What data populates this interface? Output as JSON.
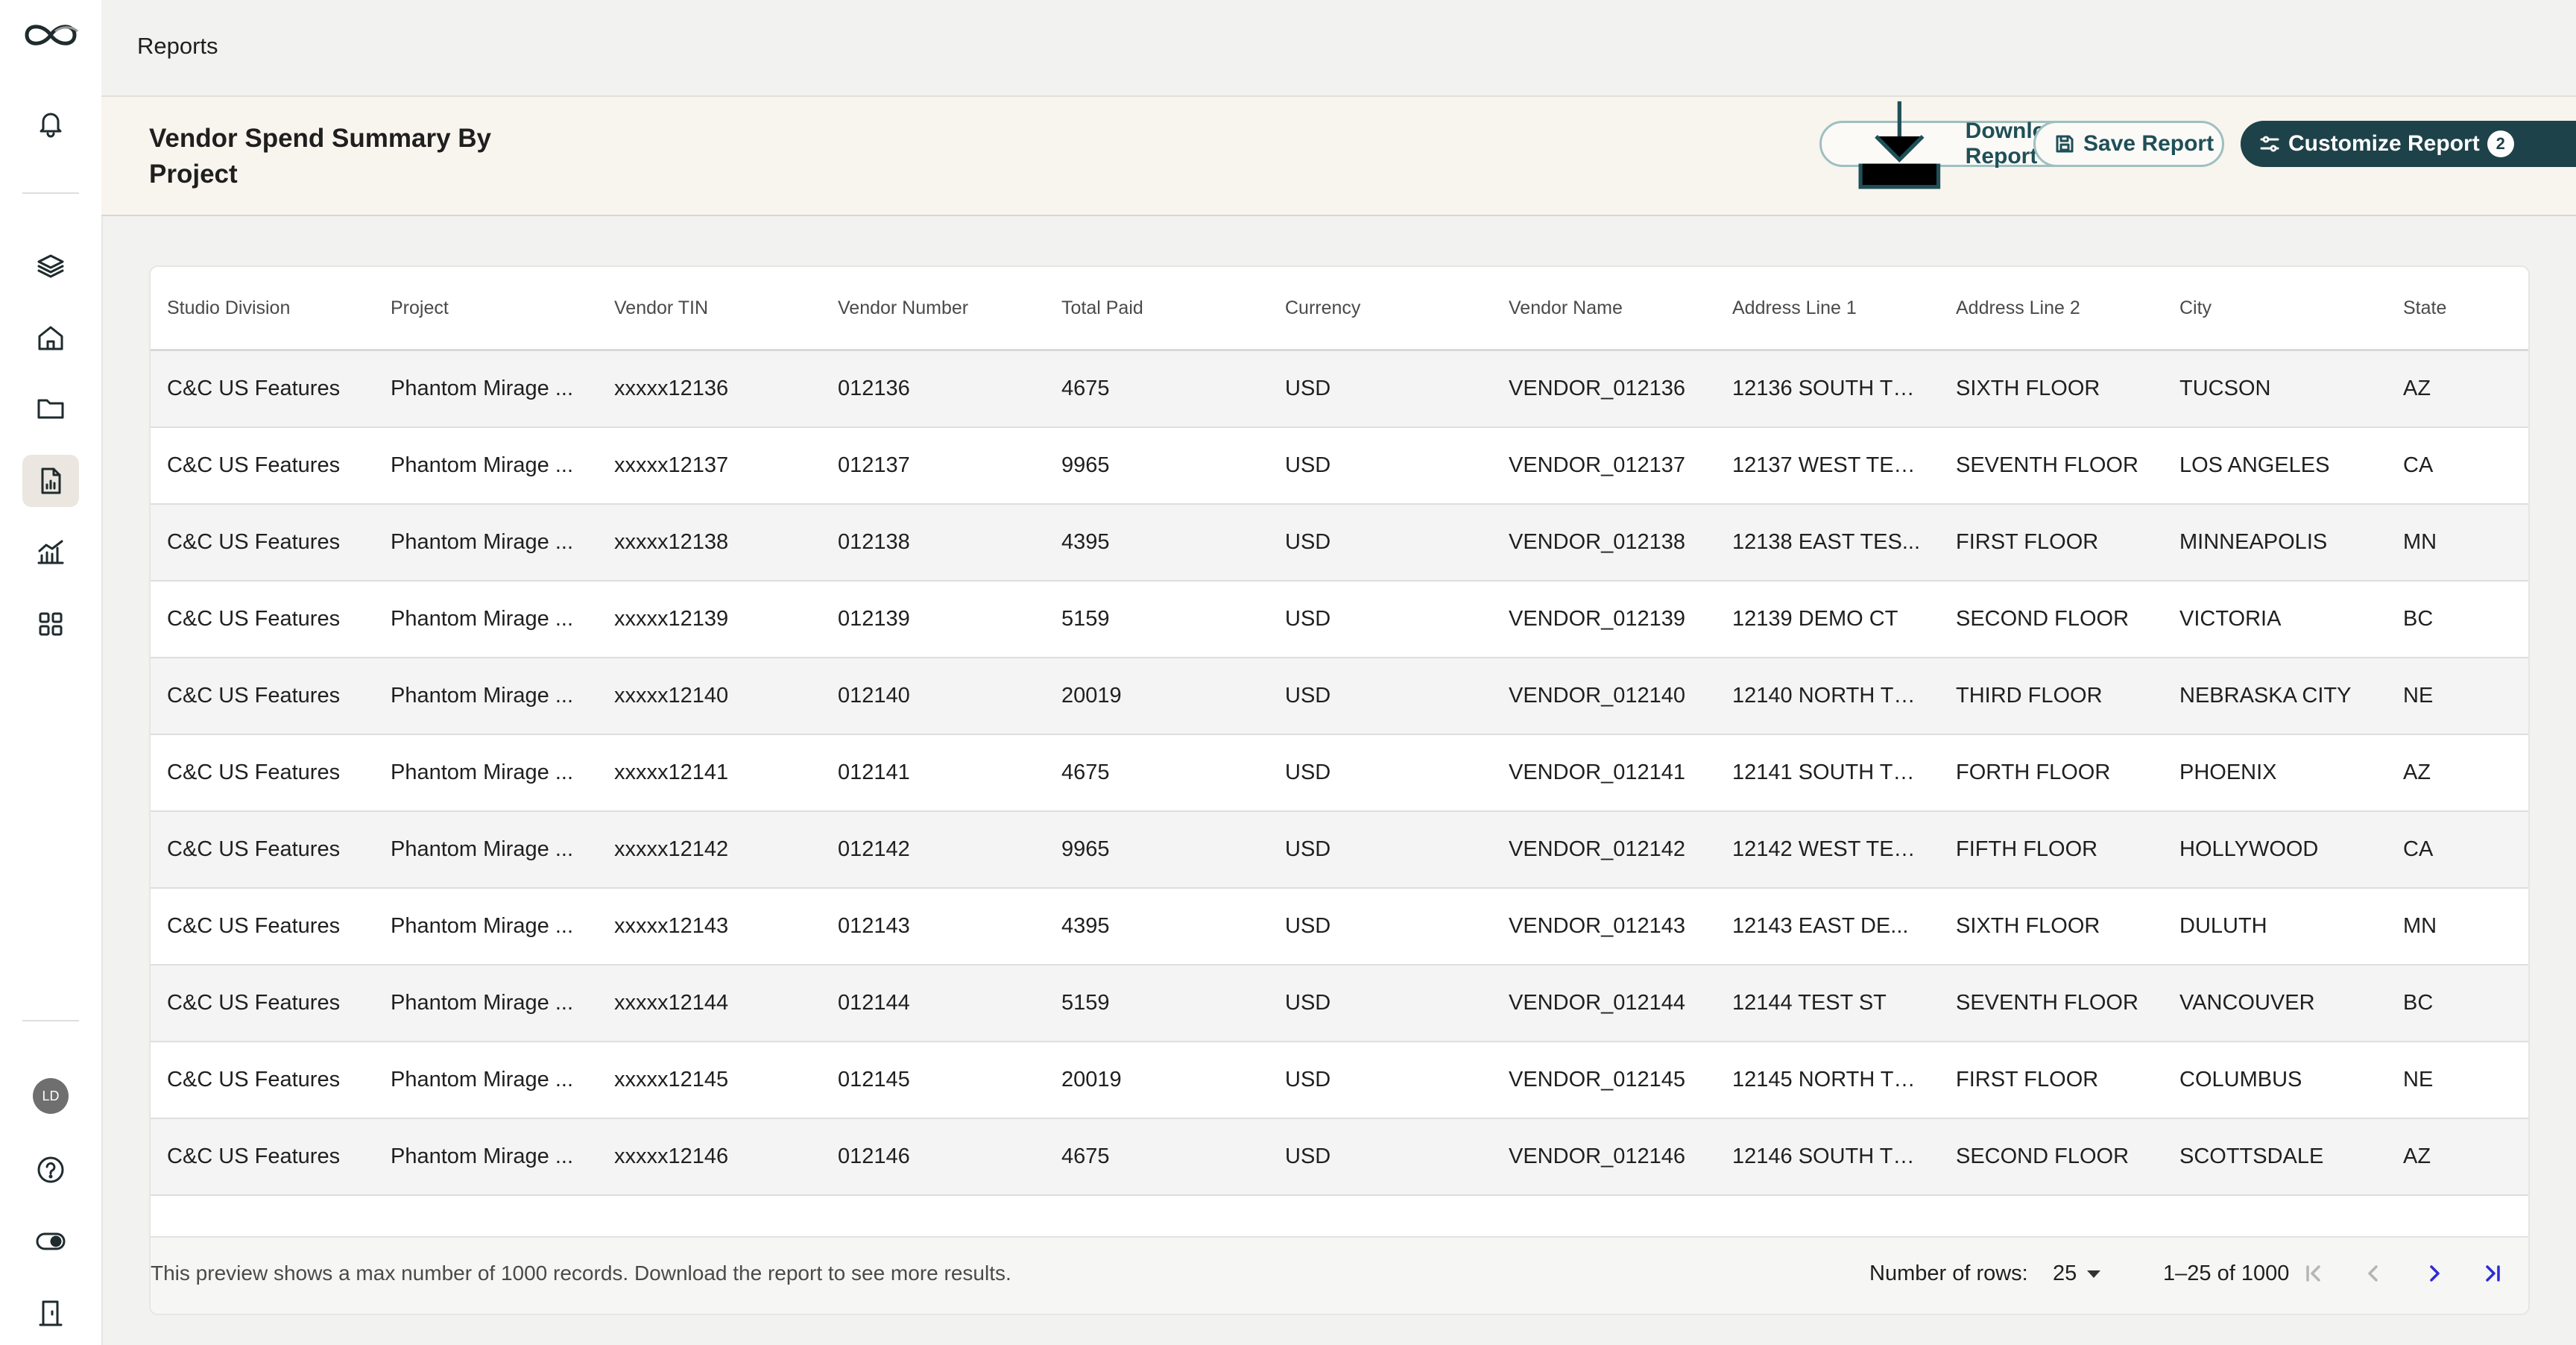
{
  "breadcrumb": "Reports",
  "page": {
    "title": "Vendor Spend Summary By Project"
  },
  "toolbar": {
    "download_label": "Download Report",
    "save_label": "Save Report",
    "customize_label": "Customize Report",
    "customize_count": "2"
  },
  "sidebar": {
    "avatar_initials": "LD",
    "items": [
      {
        "icon": "bell-icon"
      },
      {
        "icon": "layers-icon"
      },
      {
        "icon": "home-icon"
      },
      {
        "icon": "folder-icon"
      },
      {
        "icon": "report-document-icon",
        "active": true
      },
      {
        "icon": "analytics-icon"
      },
      {
        "icon": "apps-grid-icon"
      },
      {
        "icon": "help-icon"
      },
      {
        "icon": "toggle-icon"
      },
      {
        "icon": "exit-door-icon"
      }
    ]
  },
  "table": {
    "columns": [
      "Studio Division",
      "Project",
      "Vendor TIN",
      "Vendor Number",
      "Total Paid",
      "Currency",
      "Vendor Name",
      "Address Line 1",
      "Address Line 2",
      "City",
      "State"
    ],
    "rows": [
      [
        "C&C US Features",
        "Phantom Mirage ...",
        "xxxxx12136",
        "012136",
        "4675",
        "USD",
        "VENDOR_012136",
        "12136 SOUTH TE...",
        "SIXTH FLOOR",
        "TUCSON",
        "AZ"
      ],
      [
        "C&C US Features",
        "Phantom Mirage ...",
        "xxxxx12137",
        "012137",
        "9965",
        "USD",
        "VENDOR_012137",
        "12137 WEST TES...",
        "SEVENTH FLOOR",
        "LOS ANGELES",
        "CA"
      ],
      [
        "C&C US Features",
        "Phantom Mirage ...",
        "xxxxx12138",
        "012138",
        "4395",
        "USD",
        "VENDOR_012138",
        "12138 EAST TES...",
        "FIRST FLOOR",
        "MINNEAPOLIS",
        "MN"
      ],
      [
        "C&C US Features",
        "Phantom Mirage ...",
        "xxxxx12139",
        "012139",
        "5159",
        "USD",
        "VENDOR_012139",
        "12139 DEMO CT",
        "SECOND FLOOR",
        "VICTORIA",
        "BC"
      ],
      [
        "C&C US Features",
        "Phantom Mirage ...",
        "xxxxx12140",
        "012140",
        "20019",
        "USD",
        "VENDOR_012140",
        "12140 NORTH TE...",
        "THIRD FLOOR",
        "NEBRASKA CITY",
        "NE"
      ],
      [
        "C&C US Features",
        "Phantom Mirage ...",
        "xxxxx12141",
        "012141",
        "4675",
        "USD",
        "VENDOR_012141",
        "12141 SOUTH TE...",
        "FORTH FLOOR",
        "PHOENIX",
        "AZ"
      ],
      [
        "C&C US Features",
        "Phantom Mirage ...",
        "xxxxx12142",
        "012142",
        "9965",
        "USD",
        "VENDOR_012142",
        "12142 WEST TES...",
        "FIFTH FLOOR",
        "HOLLYWOOD",
        "CA"
      ],
      [
        "C&C US Features",
        "Phantom Mirage ...",
        "xxxxx12143",
        "012143",
        "4395",
        "USD",
        "VENDOR_012143",
        "12143 EAST DE...",
        "SIXTH FLOOR",
        "DULUTH",
        "MN"
      ],
      [
        "C&C US Features",
        "Phantom Mirage ...",
        "xxxxx12144",
        "012144",
        "5159",
        "USD",
        "VENDOR_012144",
        "12144 TEST ST",
        "SEVENTH FLOOR",
        "VANCOUVER",
        "BC"
      ],
      [
        "C&C US Features",
        "Phantom Mirage ...",
        "xxxxx12145",
        "012145",
        "20019",
        "USD",
        "VENDOR_012145",
        "12145 NORTH TE...",
        "FIRST FLOOR",
        "COLUMBUS",
        "NE"
      ],
      [
        "C&C US Features",
        "Phantom Mirage ...",
        "xxxxx12146",
        "012146",
        "4675",
        "USD",
        "VENDOR_012146",
        "12146 SOUTH TE...",
        "SECOND FLOOR",
        "SCOTTSDALE",
        "AZ"
      ]
    ]
  },
  "footer": {
    "note": "This preview shows a max number of 1000 records. Download the report to see more results.",
    "rows_label": "Number of rows:",
    "rows_value": "25",
    "range": "1–25 of 1000"
  },
  "colors": {
    "accent_dark": "#1e4249",
    "accent_outline": "#9fbfc0",
    "pager_active": "#2b2bd6",
    "pager_disabled": "#b5b5b5"
  }
}
